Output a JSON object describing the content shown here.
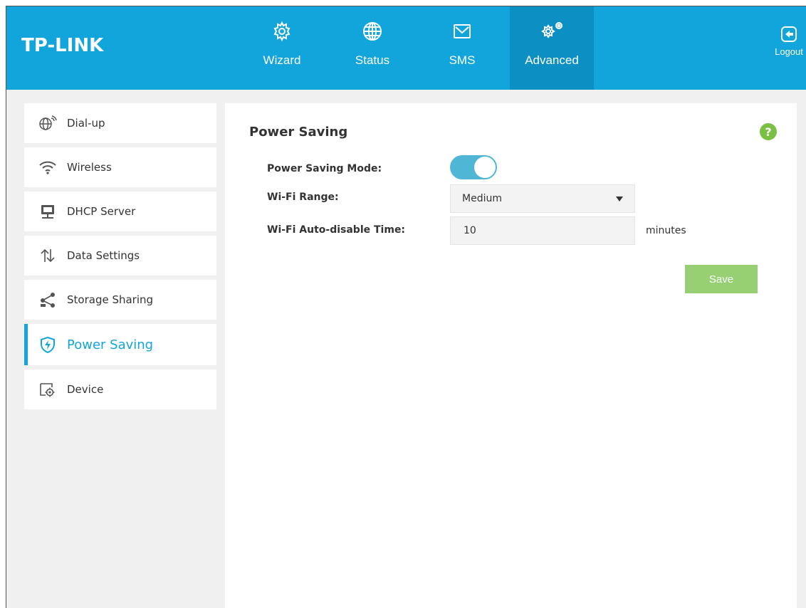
{
  "brand": "TP-LINK",
  "nav": [
    {
      "label": "Wizard",
      "icon": "gear-icon"
    },
    {
      "label": "Status",
      "icon": "globe-icon"
    },
    {
      "label": "SMS",
      "icon": "envelope-icon"
    },
    {
      "label": "Advanced",
      "icon": "gears-icon",
      "active": true
    }
  ],
  "logout": {
    "label": "Logout",
    "icon": "logout-icon"
  },
  "sidebar": {
    "items": [
      {
        "label": "Dial-up",
        "icon": "globe-antenna-icon"
      },
      {
        "label": "Wireless",
        "icon": "wifi-icon"
      },
      {
        "label": "DHCP Server",
        "icon": "network-folder-icon"
      },
      {
        "label": "Data Settings",
        "icon": "up-down-arrows-icon"
      },
      {
        "label": "Storage Sharing",
        "icon": "share-icon"
      },
      {
        "label": "Power Saving",
        "icon": "power-shield-icon",
        "active": true
      },
      {
        "label": "Device",
        "icon": "device-settings-icon"
      }
    ]
  },
  "main": {
    "title": "Power Saving",
    "help_label": "?",
    "form": {
      "power_saving_mode_label": "Power Saving Mode:",
      "power_saving_mode_on": true,
      "wifi_range_label": "Wi-Fi Range:",
      "wifi_range_value": "Medium",
      "auto_disable_label": "Wi-Fi Auto-disable Time:",
      "auto_disable_value": "10",
      "auto_disable_unit": "minutes"
    },
    "save_label": "Save"
  },
  "colors": {
    "header": "#12a5dc",
    "header_active": "#0c90c3",
    "accent": "#12a5dc",
    "toggle_on": "#4fb6d6",
    "save": "#96d072",
    "help": "#7ac043"
  }
}
